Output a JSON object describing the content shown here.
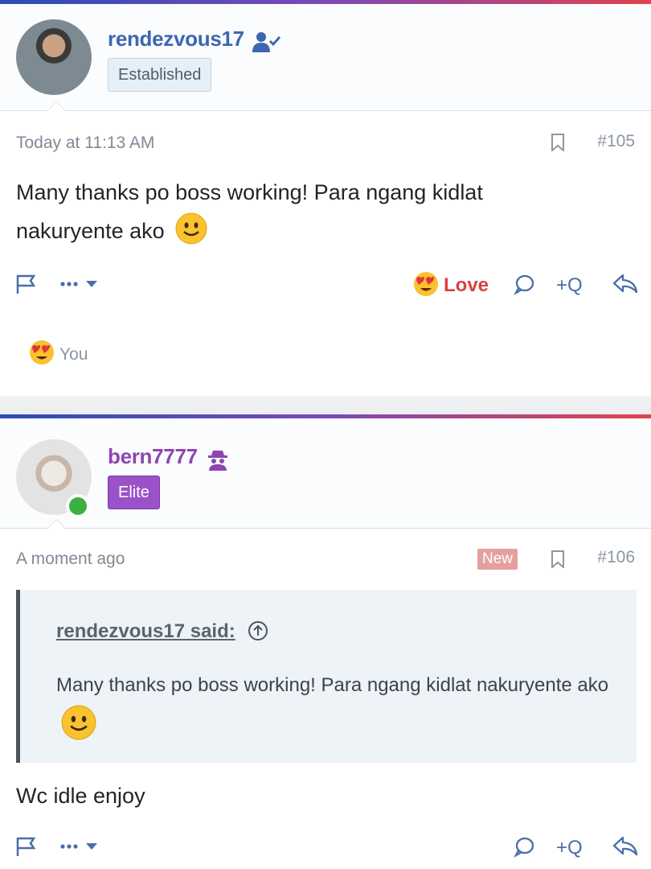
{
  "posts": [
    {
      "username": "rendezvous17",
      "user_icon": "user-check-icon",
      "badge": "Established",
      "time": "Today at 11:13 AM",
      "post_number": "#105",
      "message": "Many thanks po boss working! Para ngang kidlat nakuryente ako",
      "reaction_label": "Love",
      "reply_quote_label": "+Q",
      "reactions_by": "You"
    },
    {
      "username": "bern7777",
      "user_icon": "spy-icon",
      "badge": "Elite",
      "time": "A moment ago",
      "new_badge": "New",
      "post_number": "#106",
      "quote": {
        "author": "rendezvous17 said:",
        "text": "Many thanks po boss working! Para ngang kidlat nakuryente ako"
      },
      "message": "Wc idle enjoy",
      "reply_quote_label": "+Q"
    }
  ],
  "colors": {
    "link_blue": "#3c67b0",
    "elite_purple": "#9b52c8",
    "love_red": "#d94040",
    "online_green": "#3cb043",
    "new_badge": "#e5a09e"
  }
}
